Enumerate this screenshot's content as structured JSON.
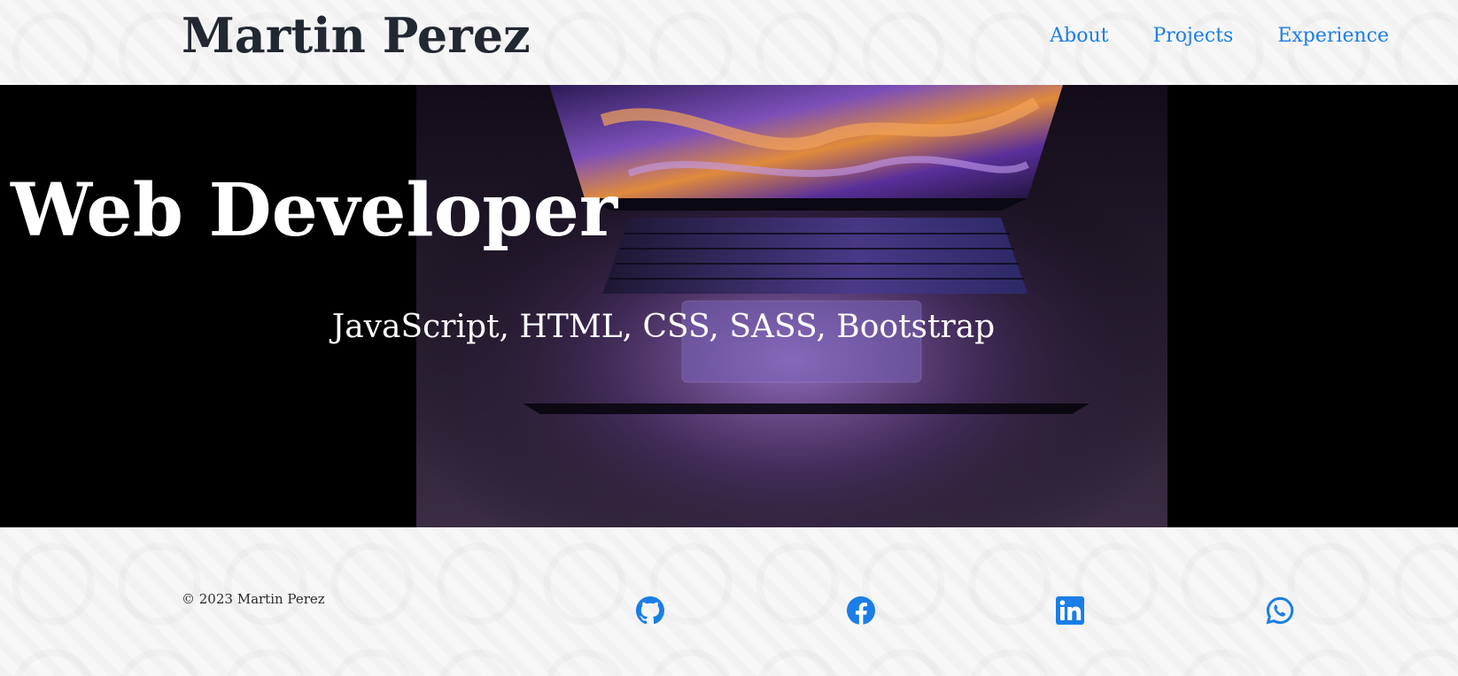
{
  "header": {
    "brand": "Martin Perez",
    "nav": [
      {
        "label": "About"
      },
      {
        "label": "Projects"
      },
      {
        "label": "Experience"
      }
    ]
  },
  "hero": {
    "title": "Web Developer",
    "subtitle": "JavaScript, HTML, CSS, SASS, Bootstrap",
    "image": "laptop-photo"
  },
  "footer": {
    "copyright": "© 2023 Martin Perez",
    "social": [
      {
        "icon": "github-icon"
      },
      {
        "icon": "facebook-icon"
      },
      {
        "icon": "linkedin-icon"
      },
      {
        "icon": "whatsapp-icon"
      }
    ]
  },
  "colors": {
    "link": "#1a7ee6",
    "brand_text": "#222831",
    "hero_bg": "#000000"
  }
}
